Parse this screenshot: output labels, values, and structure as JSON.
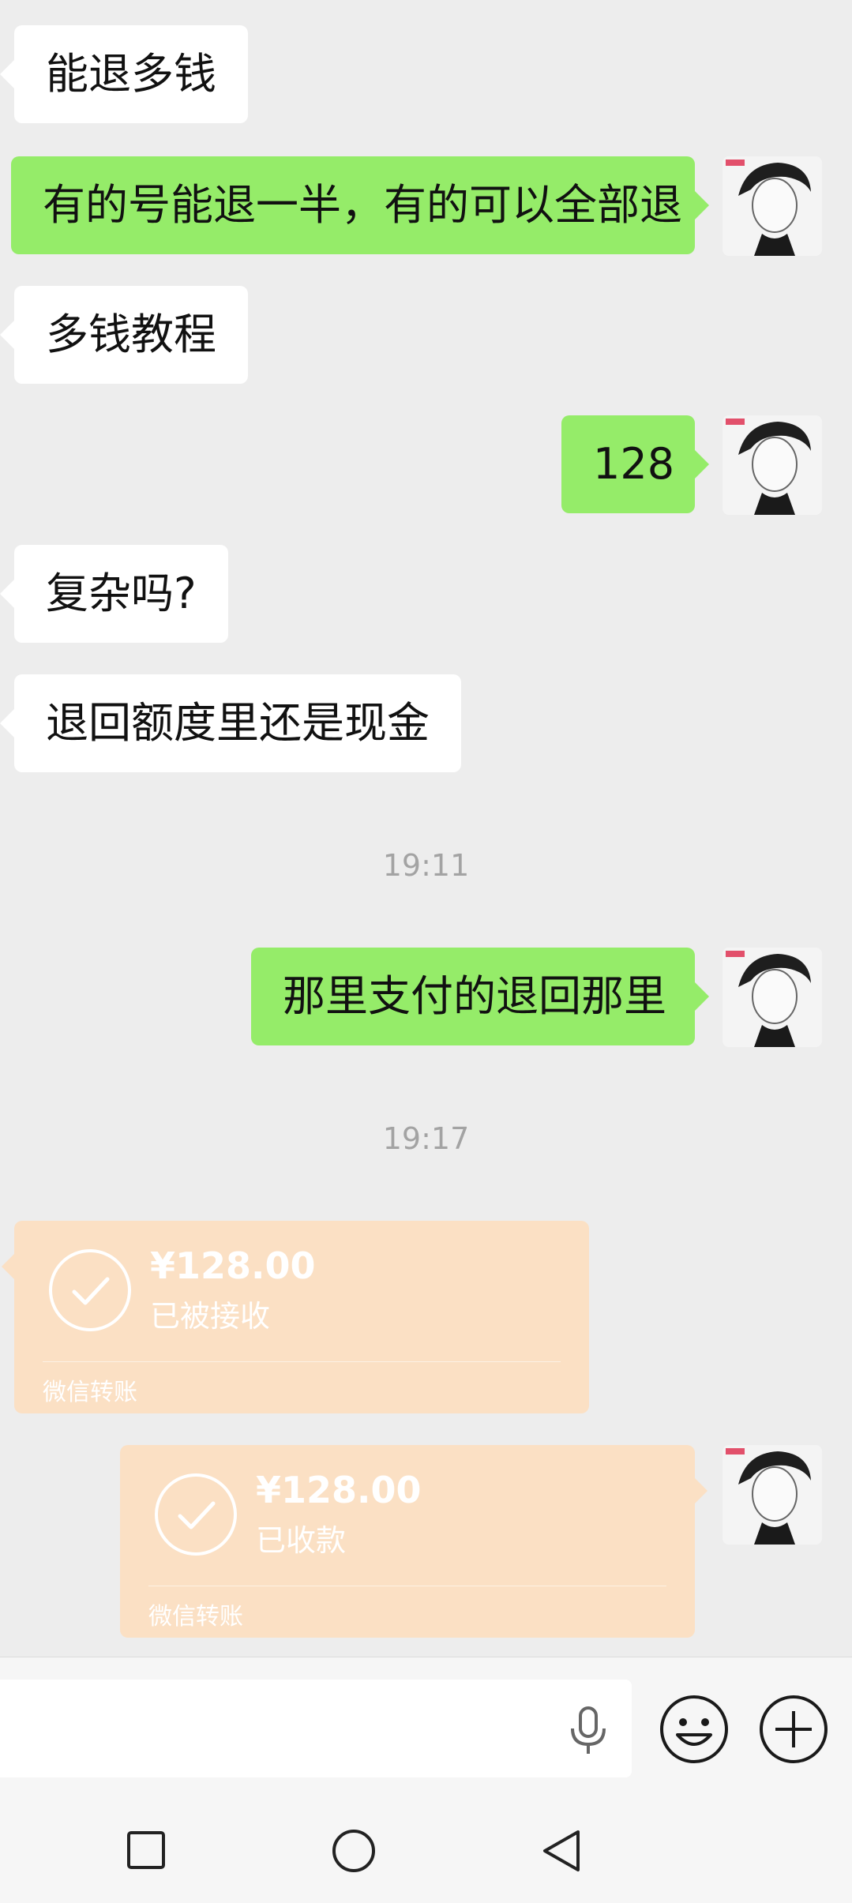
{
  "messages": [
    {
      "side": "left",
      "text": "能退多钱"
    },
    {
      "side": "right",
      "text": "有的号能退一半，有的可以全部退"
    },
    {
      "side": "left",
      "text": "多钱教程"
    },
    {
      "side": "right",
      "text": "128"
    },
    {
      "side": "left",
      "text": "复杂吗?"
    },
    {
      "side": "left",
      "text": "退回额度里还是现金"
    },
    {
      "side": "time",
      "text": "19:11"
    },
    {
      "side": "right",
      "text": "那里支付的退回那里"
    },
    {
      "side": "time",
      "text": "19:17"
    }
  ],
  "transfers": [
    {
      "side": "left",
      "amount": "¥128.00",
      "status": "已被接收",
      "footer": "微信转账"
    },
    {
      "side": "right",
      "amount": "¥128.00",
      "status": "已收款",
      "footer": "微信转账"
    }
  ],
  "icons": {
    "voice": "microphone-icon",
    "emoji": "emoji-icon",
    "more": "plus-icon",
    "nav_recent": "square-icon",
    "nav_home": "circle-icon",
    "nav_back": "triangle-back-icon"
  },
  "colors": {
    "background": "#ededed",
    "bubble_self": "#95ec69",
    "bubble_other": "#ffffff",
    "transfer": "#fbe0c4"
  }
}
